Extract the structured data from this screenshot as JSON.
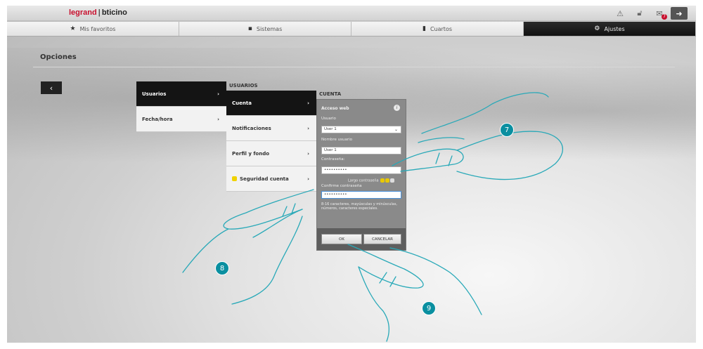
{
  "header": {
    "logo_part1": "legrand",
    "logo_part2": "bticino",
    "icons": [
      "alert-icon",
      "unlock-icon",
      "mail-icon",
      "logout-icon"
    ],
    "mail_badge": "7"
  },
  "tabs": [
    {
      "label": "Mis favoritos",
      "icon": "star-icon"
    },
    {
      "label": "Sistemas",
      "icon": "system-icon"
    },
    {
      "label": "Cuartos",
      "icon": "room-icon"
    },
    {
      "label": "Ajustes",
      "icon": "gear-icon",
      "active": true
    }
  ],
  "page": {
    "title": "Opciones",
    "back": "‹"
  },
  "menu1": {
    "items": [
      {
        "label": "Usuarios",
        "arrow": "›",
        "active": true
      },
      {
        "label": "Fecha/hora",
        "arrow": "›"
      }
    ]
  },
  "menu2": {
    "title": "USUARIOS",
    "items": [
      {
        "label": "Cuenta",
        "arrow": "›",
        "active": true
      },
      {
        "label": "Notificaciones",
        "arrow": "›"
      },
      {
        "label": "Perfil y fondo",
        "arrow": "›"
      },
      {
        "label": "Seguridad cuenta",
        "arrow": "›",
        "icon": "lock-icon"
      }
    ]
  },
  "cuenta": {
    "title": "CUENTA",
    "section": "Acceso web",
    "info": "i",
    "usuario_label": "Usuario",
    "usuario_value": "User 1",
    "nombre_label": "Nombre usuario",
    "nombre_value": "User 1",
    "pass_label": "Contraseña:",
    "pass_value": "••••••••••",
    "strength_label": "Largo contraseña",
    "confirm_label": "Confirme contraseña",
    "confirm_value": "••••••••••",
    "hint": "8-16 caracteres, mayúsculas y minúsculas, números, caracteres especiales.",
    "ok": "OK",
    "cancel": "CANCELAR"
  },
  "steps": [
    "7",
    "8",
    "9"
  ],
  "colors": {
    "accent_step": "#0a8fa0",
    "brand_red": "#c8102e",
    "active_tab": "#141414",
    "hand_outline": "#29a9b8"
  }
}
